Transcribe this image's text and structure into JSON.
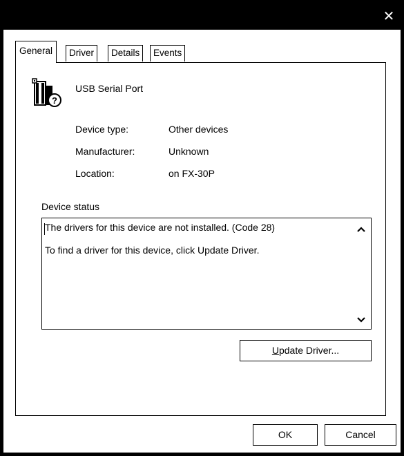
{
  "window": {
    "close_glyph": "✕"
  },
  "tabs": [
    {
      "label": "General",
      "active": true
    },
    {
      "label": "Driver",
      "active": false
    },
    {
      "label": "Details",
      "active": false
    },
    {
      "label": "Events",
      "active": false
    }
  ],
  "device": {
    "icon": "unknown-device-icon",
    "name": "USB Serial Port"
  },
  "properties": [
    {
      "label": "Device type:",
      "value": "Other devices"
    },
    {
      "label": "Manufacturer:",
      "value": "Unknown"
    },
    {
      "label": "Location:",
      "value": "on FX-30P"
    }
  ],
  "status": {
    "title": "Device status",
    "line1": "The drivers for this device are not installed. (Code 28)",
    "line2": "To find a driver for this device, click Update Driver."
  },
  "buttons": {
    "update_prefix": "U",
    "update_rest": "pdate Driver...",
    "ok": "OK",
    "cancel": "Cancel"
  }
}
